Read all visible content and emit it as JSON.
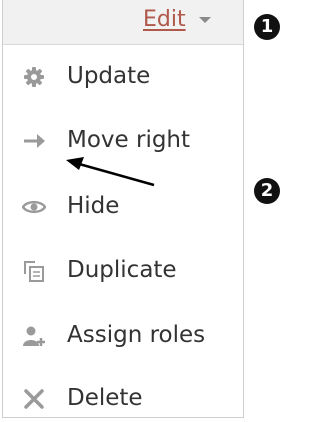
{
  "menu": {
    "trigger_label": "Edit",
    "items": [
      {
        "label": "Update",
        "icon": "gear-icon"
      },
      {
        "label": "Move right",
        "icon": "arrow-right-icon"
      },
      {
        "label": "Hide",
        "icon": "eye-icon"
      },
      {
        "label": "Duplicate",
        "icon": "duplicate-icon"
      },
      {
        "label": "Assign roles",
        "icon": "assign-roles-icon"
      },
      {
        "label": "Delete",
        "icon": "close-icon"
      }
    ]
  },
  "annotations": {
    "badge_1": "1",
    "badge_2": "2"
  },
  "colors": {
    "trigger": "#b0584a",
    "icon": "#9a9a9a",
    "text": "#333333",
    "header_bg": "#f1f1f1"
  }
}
